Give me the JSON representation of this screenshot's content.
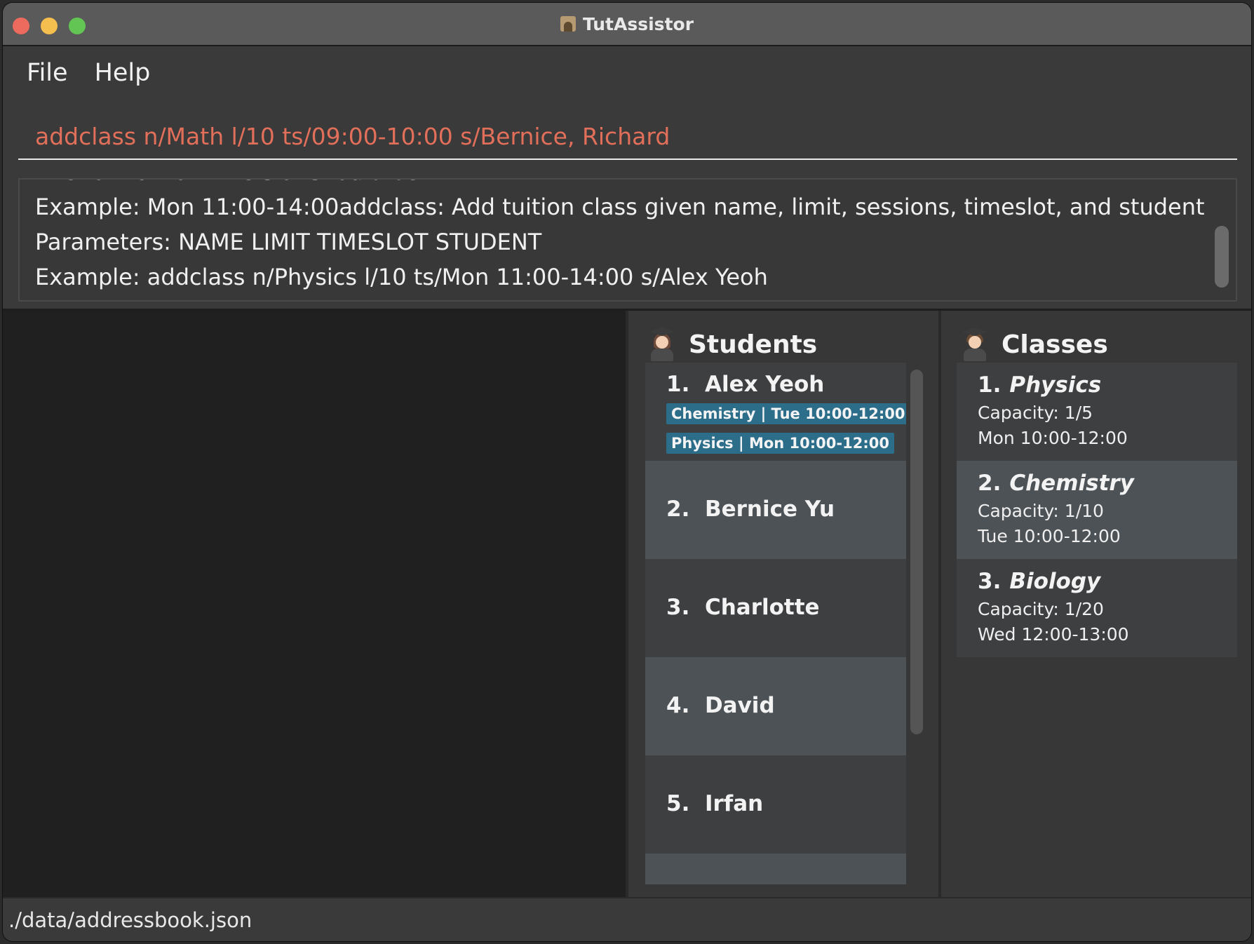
{
  "window": {
    "title": "TutAssistor"
  },
  "menu": {
    "items": [
      "File",
      "Help"
    ]
  },
  "command": {
    "value": "addclass n/Math l/10 ts/09:00-10:00 s/Bernice, Richard"
  },
  "result": {
    "lines": [
      "The format for time slot should be WWW HH:MM-HH:MM",
      "Example: Mon 11:00-14:00addclass: Add tuition class given name, limit, sessions, timeslot, and student",
      "Parameters: NAME LIMIT TIMESLOT STUDENT",
      "Example: addclass n/Physics l/10 ts/Mon 11:00-14:00 s/Alex Yeoh"
    ]
  },
  "students": {
    "title": "Students",
    "items": [
      {
        "index": "1.",
        "name": "Alex Yeoh",
        "tags": [
          "Chemistry | Tue 10:00-12:00",
          "Physics | Mon 10:00-12:00"
        ]
      },
      {
        "index": "2.",
        "name": "Bernice Yu",
        "tags": []
      },
      {
        "index": "3.",
        "name": "Charlotte",
        "tags": []
      },
      {
        "index": "4.",
        "name": "David",
        "tags": []
      },
      {
        "index": "5.",
        "name": "Irfan",
        "tags": []
      }
    ]
  },
  "classes": {
    "title": "Classes",
    "items": [
      {
        "index": "1.",
        "name": "Physics",
        "capacity": "Capacity: 1/5",
        "timeslot": "Mon 10:00-12:00"
      },
      {
        "index": "2.",
        "name": "Chemistry",
        "capacity": "Capacity: 1/10",
        "timeslot": "Tue 10:00-12:00"
      },
      {
        "index": "3.",
        "name": "Biology",
        "capacity": "Capacity: 1/20",
        "timeslot": "Wed 12:00-13:00"
      }
    ]
  },
  "status": {
    "path": "./data/addressbook.json"
  }
}
